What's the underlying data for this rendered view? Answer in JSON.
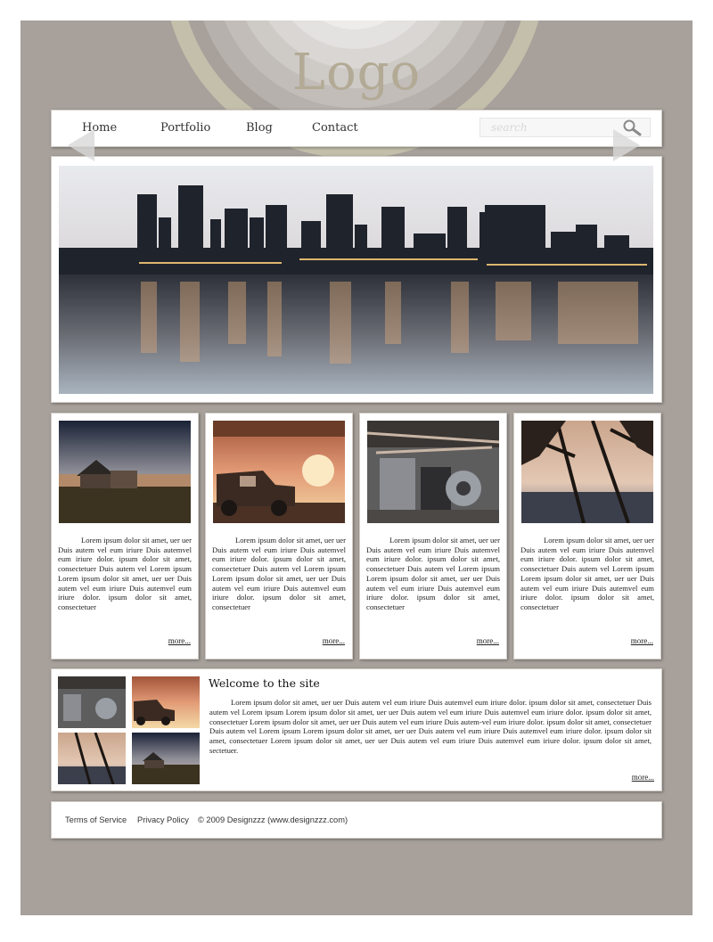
{
  "header": {
    "logo_text": "Logo"
  },
  "nav": {
    "items": [
      {
        "label": "Home"
      },
      {
        "label": "Portfolio"
      },
      {
        "label": "Blog"
      },
      {
        "label": "Contact"
      }
    ],
    "search_placeholder": "search",
    "search_icon": "search-icon"
  },
  "slider": {
    "image": "city-skyline-at-dusk",
    "prev_icon": "arrow-left-icon",
    "next_icon": "arrow-right-icon"
  },
  "cards": [
    {
      "image": "old-farmhouse",
      "text": "Lorem ipsum dolor sit amet, uer uer Duis autem vel eum iriure Duis autemvel eum iriure dolor. ipsum dolor sit amet, consectetuer Duis autem vel Lorem ipsum Lorem ipsum dolor sit amet, uer uer Duis autem vel eum iriure Duis autemvel eum iriure dolor. ipsum dolor sit amet, consectetuer",
      "more": "more..."
    },
    {
      "image": "old-pickup-truck",
      "text": "Lorem ipsum dolor sit amet, uer uer Duis autem vel eum iriure Duis autemvel eum iriure dolor. ipsum dolor sit amet, consectetuer Duis autem vel Lorem ipsum Lorem ipsum dolor sit amet, uer uer Duis autem vel eum iriure Duis autemvel eum iriure dolor. ipsum dolor sit amet, consectetuer",
      "more": "more..."
    },
    {
      "image": "industrial-machinery",
      "text": "Lorem ipsum dolor sit amet, uer uer Duis autem vel eum iriure Duis autemvel eum iriure dolor. ipsum dolor sit amet, consectetuer Duis autem vel Lorem ipsum Lorem ipsum dolor sit amet, uer uer Duis autem vel eum iriure Duis autemvel eum iriure dolor. ipsum dolor sit amet, consectetuer",
      "more": "more..."
    },
    {
      "image": "trees-at-sunset",
      "text": "Lorem ipsum dolor sit amet, uer uer Duis autem vel eum iriure Duis autemvel eum iriure dolor. ipsum dolor sit amet, consectetuer Duis autem vel Lorem ipsum Lorem ipsum dolor sit amet, uer uer Duis autem vel eum iriure Duis autemvel eum iriure dolor. ipsum dolor sit amet, consectetuer",
      "more": "more..."
    }
  ],
  "welcome": {
    "title": "Welcome to the site",
    "text": "Lorem ipsum dolor sit amet, uer uer Duis autem vel eum iriure Duis autemvel eum iriure dolor. ipsum dolor sit amet, consectetuer Duis autem vel Lorem ipsum Lorem ipsum dolor sit amet, uer uer Duis autem vel eum iriure Duis autemvel eum iriure dolor. ipsum dolor sit amet, consectetuer Lorem ipsum dolor sit amet, uer uer Duis autem vel eum iriure Duis autem-vel eum iriure dolor. ipsum dolor sit amet, consectetuer Duis autem vel Lorem ipsum Lorem ipsum dolor sit amet, uer uer Duis autem vel eum iriure Duis autemvel eum iriure dolor. ipsum dolor sit amet, consectetuer Lorem ipsum dolor sit amet, uer uer Duis autem vel eum iriure Duis autemvel eum iriure dolor. ipsum dolor sit amet, sectetuer.",
    "more": "more...",
    "thumbnails": [
      "industrial-machinery",
      "old-pickup-truck",
      "trees-at-sunset",
      "old-farmhouse"
    ]
  },
  "footer": {
    "terms": "Terms of Service",
    "privacy": "Privacy Policy",
    "copyright": "© 2009  Designzzz (www.designzzz.com)"
  },
  "colors": {
    "background": "#a7a09b",
    "panel": "#ffffff",
    "logo": "#b3aa96"
  }
}
